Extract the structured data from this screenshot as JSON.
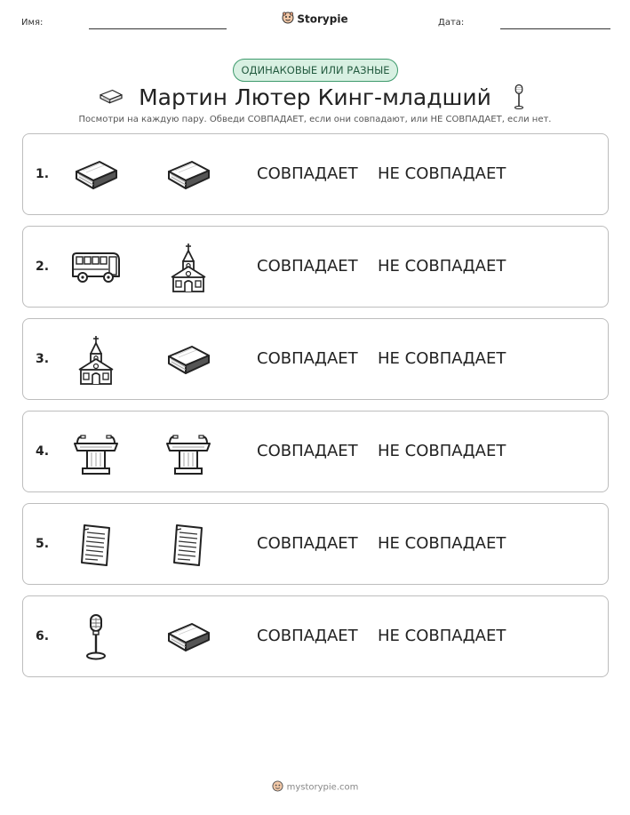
{
  "header": {
    "name_label": "Имя:",
    "date_label": "Дата:",
    "brand": "Storypie"
  },
  "badge": "ОДИНАКОВЫЕ ИЛИ РАЗНЫЕ",
  "title": "Мартин Лютер Кинг-младший",
  "title_icons": [
    "book-icon",
    "microphone-icon"
  ],
  "instructions": "Посмотри на каждую пару. Обведи СОВПАДАЕТ, если они совпадают, или НЕ СОВПАДАЕТ, если нет.",
  "rows": [
    {
      "number": "1.",
      "left": "book-icon",
      "right": "book-icon",
      "match_label": "СОВПАДАЕТ",
      "nomatch_label": "НЕ СОВПАДАЕТ"
    },
    {
      "number": "2.",
      "left": "bus-icon",
      "right": "church-icon",
      "match_label": "СОВПАДАЕТ",
      "nomatch_label": "НЕ СОВПАДАЕТ"
    },
    {
      "number": "3.",
      "left": "church-icon",
      "right": "book-icon",
      "match_label": "СОВПАДАЕТ",
      "nomatch_label": "НЕ СОВПАДАЕТ"
    },
    {
      "number": "4.",
      "left": "fountain-icon",
      "right": "fountain-icon",
      "match_label": "СОВПАДАЕТ",
      "nomatch_label": "НЕ СОВПАДАЕТ"
    },
    {
      "number": "5.",
      "left": "document-icon",
      "right": "document-icon",
      "match_label": "СОВПАДАЕТ",
      "nomatch_label": "НЕ СОВПАДАЕТ"
    },
    {
      "number": "6.",
      "left": "microphone-icon",
      "right": "book-icon",
      "match_label": "СОВПАДАЕТ",
      "nomatch_label": "НЕ СОВПАДАЕТ"
    }
  ],
  "footer": "mystorypie.com"
}
